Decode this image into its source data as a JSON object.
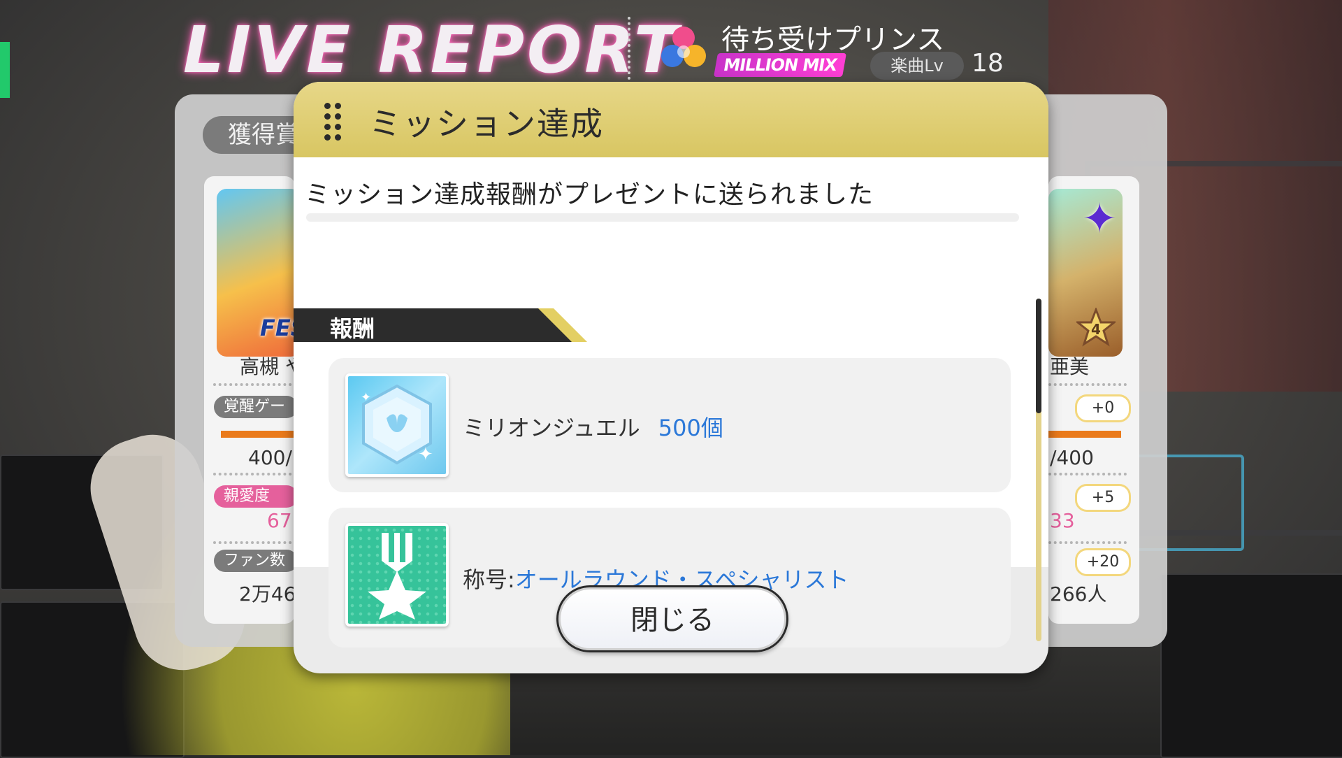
{
  "header": {
    "title": "LIVE REPORT",
    "song_title": "待ち受けプリンス",
    "mix_badge": "MILLION MIX",
    "level_label": "楽曲Lv",
    "level_value": "18",
    "song_icon": "tri-color-heart-icon"
  },
  "report": {
    "section_label": "獲得賞",
    "left_idol": {
      "name": "高槻 や",
      "badge": "FES",
      "awaken_label": "覚醒ゲージ",
      "awaken_value": "400/",
      "affection_label": "親愛度",
      "affection_value": "67",
      "fans_label": "ファン数",
      "fans_value": "2万46"
    },
    "right_idol": {
      "name": "亜美",
      "awaken_plus": "+0",
      "awaken_value": "/400",
      "affection_plus": "+5",
      "affection_value": "33",
      "fans_plus": "+20",
      "fans_value": "266人",
      "rank": "4"
    }
  },
  "modal": {
    "title": "ミッション達成",
    "message": "ミッション達成報酬がプレゼントに送られました",
    "section_label": "報酬",
    "rewards": [
      {
        "icon": "million-jewel-icon",
        "name": "ミリオンジュエル",
        "quantity": "500個"
      },
      {
        "icon": "title-medal-icon",
        "prefix": "称号:",
        "name": "オールラウンド・スペシャリスト"
      }
    ],
    "close_label": "閉じる"
  },
  "colors": {
    "modal_header": "#E3D277",
    "link_blue": "#2B78D8",
    "title_glow": "#FF5FB7",
    "mix_pink": "#E23BDA"
  }
}
